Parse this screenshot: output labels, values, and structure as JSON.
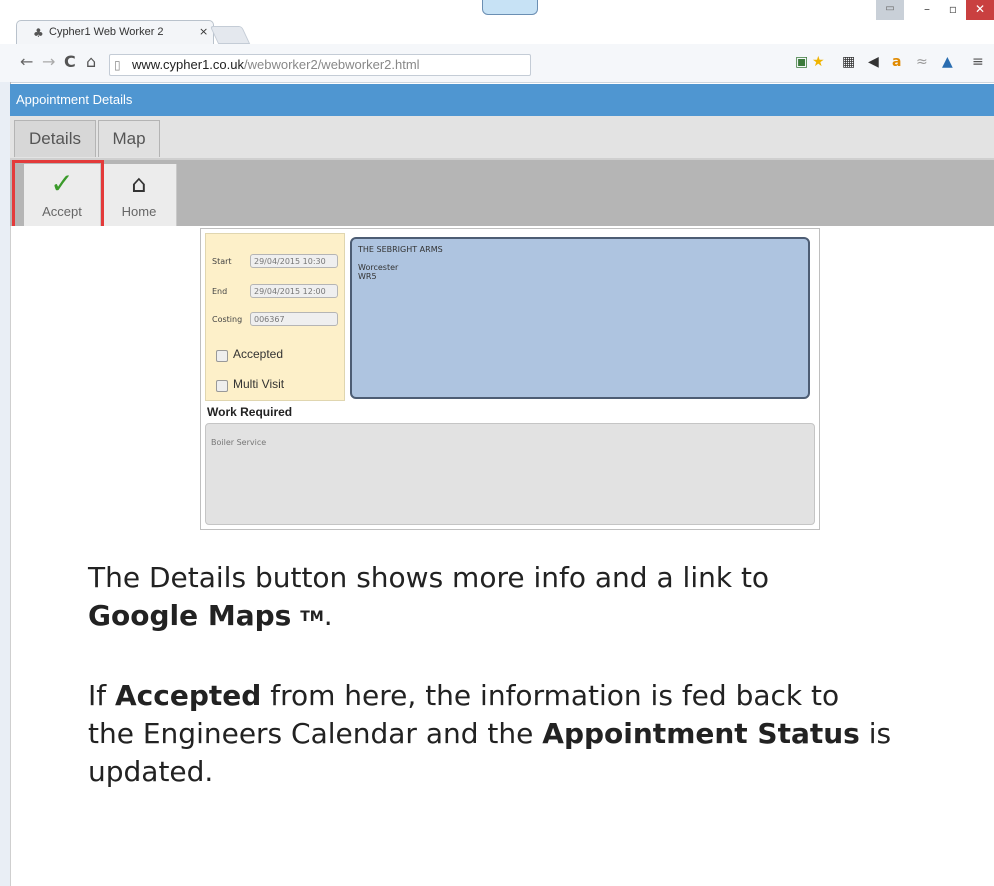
{
  "browser": {
    "tab_title": "Cypher1 Web Worker 2",
    "tab_close": "×",
    "url_host": "www.cypher1.co.uk",
    "url_path": "/webworker2/webworker2.html"
  },
  "app": {
    "title": "Appointment Details",
    "tabs": [
      {
        "label": "Details",
        "active": true
      },
      {
        "label": "Map",
        "active": false
      }
    ],
    "actions": {
      "accept_label": "Accept",
      "home_label": "Home"
    }
  },
  "appointment": {
    "start_label": "Start",
    "start_value": "29/04/2015 10:30",
    "end_label": "End",
    "end_value": "29/04/2015 12:00",
    "costing_label": "Costing",
    "costing_value": "006367",
    "accepted_label": "Accepted",
    "multi_visit_label": "Multi Visit",
    "address_lines": [
      "THE SEBRIGHT ARMS",
      "Worcester",
      "WR5"
    ],
    "work_required_label": "Work Required",
    "work_required_text": "Boiler Service"
  },
  "caption": {
    "line1": "The Details button shows more info and a link to",
    "line2": "Google Maps",
    "tm": "TM",
    "period": ".",
    "p2_pre": "If ",
    "p2_bold1": "Accepted",
    "p2_mid": " from here, the information is fed back to",
    "p3_pre": "the Engineers Calendar and the ",
    "p3_bold": "Appointment Status",
    "p3_post": " is",
    "p4": "updated."
  },
  "colors": {
    "appbar": "#4f96d1",
    "highlight": "#e33a3a",
    "accept_check": "#3a9a2a"
  },
  "icons": [
    "browser-favicon",
    "back-icon",
    "forward-icon",
    "reload-icon",
    "home-nav-icon",
    "page-icon",
    "checkmark-icon",
    "house-icon"
  ]
}
